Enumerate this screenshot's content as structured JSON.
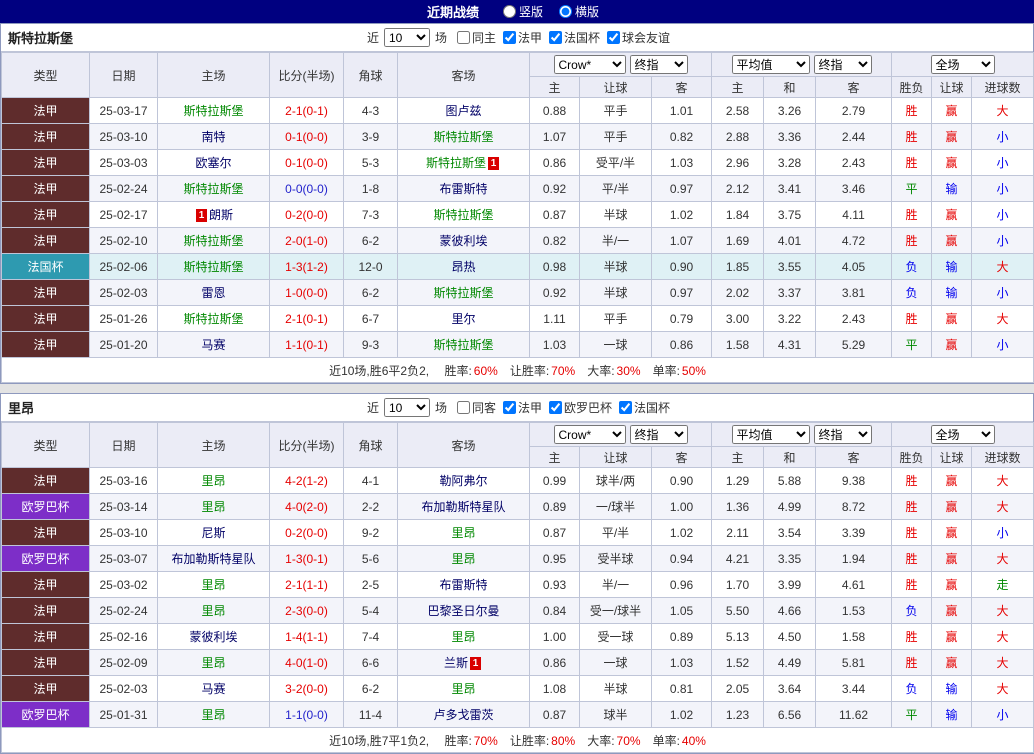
{
  "title_bar": {
    "title": "近期战绩",
    "layout_options": [
      {
        "label": "竖版",
        "checked": false
      },
      {
        "label": "横版",
        "checked": true
      }
    ]
  },
  "filter_labels": {
    "prefix": "近",
    "suffix": "场"
  },
  "table_header": {
    "type": "类型",
    "date": "日期",
    "home": "主场",
    "score": "比分(半场)",
    "corner": "角球",
    "away": "客场",
    "odds_source_select": "Crow*",
    "odds_time_select": "终指",
    "avg_select": "平均值",
    "avg_time_select": "终指",
    "scope_select": "全场",
    "sub": [
      "主",
      "让球",
      "客",
      "主",
      "和",
      "客",
      "胜负",
      "让球",
      "进球数"
    ]
  },
  "colors": {
    "leagues": {
      "法甲": "#5F2C2C",
      "法国杯": "#2E9AB0",
      "欧罗巴杯": "#7D2EC8"
    },
    "cup_row_bg": {
      "法国杯": "#DFF1F5"
    },
    "focus_team": "#008800",
    "team": "#000066",
    "score_red": "#E60000",
    "score_blue": "#2222CC",
    "outcome": {
      "胜": "#E60000",
      "平": "#008800",
      "负": "#0000EE",
      "赢": "#E60000",
      "走": "#008800",
      "输": "#0000EE",
      "大": "#E60000",
      "小": "#0000EE"
    }
  },
  "sections": [
    {
      "team": "斯特拉斯堡",
      "filter": {
        "count": "10",
        "checkboxes": [
          {
            "label": "同主",
            "checked": false
          },
          {
            "label": "法甲",
            "checked": true
          },
          {
            "label": "法国杯",
            "checked": true
          },
          {
            "label": "球会友谊",
            "checked": true
          }
        ]
      },
      "rows": [
        {
          "league": "法甲",
          "date": "25-03-17",
          "home": "斯特拉斯堡",
          "home_focus": true,
          "home_card": "",
          "away": "图卢兹",
          "away_focus": false,
          "away_card": "",
          "score": "2-1(0-1)",
          "score_color": "red",
          "corner": "4-3",
          "o1": "0.88",
          "handicap": "平手",
          "o2": "1.01",
          "a1": "2.58",
          "a2": "3.26",
          "a3": "2.79",
          "res": "胜",
          "let": "赢",
          "goal": "大"
        },
        {
          "league": "法甲",
          "date": "25-03-10",
          "home": "南特",
          "home_focus": false,
          "home_card": "",
          "away": "斯特拉斯堡",
          "away_focus": true,
          "away_card": "",
          "score": "0-1(0-0)",
          "score_color": "red",
          "corner": "3-9",
          "o1": "1.07",
          "handicap": "平手",
          "o2": "0.82",
          "a1": "2.88",
          "a2": "3.36",
          "a3": "2.44",
          "res": "胜",
          "let": "赢",
          "goal": "小"
        },
        {
          "league": "法甲",
          "date": "25-03-03",
          "home": "欧塞尔",
          "home_focus": false,
          "home_card": "",
          "away": "斯特拉斯堡",
          "away_focus": true,
          "away_card": "1",
          "score": "0-1(0-0)",
          "score_color": "red",
          "corner": "5-3",
          "o1": "0.86",
          "handicap": "受平/半",
          "o2": "1.03",
          "a1": "2.96",
          "a2": "3.28",
          "a3": "2.43",
          "res": "胜",
          "let": "赢",
          "goal": "小"
        },
        {
          "league": "法甲",
          "date": "25-02-24",
          "home": "斯特拉斯堡",
          "home_focus": true,
          "home_card": "",
          "away": "布雷斯特",
          "away_focus": false,
          "away_card": "",
          "score": "0-0(0-0)",
          "score_color": "blue",
          "corner": "1-8",
          "o1": "0.92",
          "handicap": "平/半",
          "o2": "0.97",
          "a1": "2.12",
          "a2": "3.41",
          "a3": "3.46",
          "res": "平",
          "let": "输",
          "goal": "小"
        },
        {
          "league": "法甲",
          "date": "25-02-17",
          "home": "朗斯",
          "home_focus": false,
          "home_card": "1",
          "away": "斯特拉斯堡",
          "away_focus": true,
          "away_card": "",
          "score": "0-2(0-0)",
          "score_color": "red",
          "corner": "7-3",
          "o1": "0.87",
          "handicap": "半球",
          "o2": "1.02",
          "a1": "1.84",
          "a2": "3.75",
          "a3": "4.11",
          "res": "胜",
          "let": "赢",
          "goal": "小"
        },
        {
          "league": "法甲",
          "date": "25-02-10",
          "home": "斯特拉斯堡",
          "home_focus": true,
          "home_card": "",
          "away": "蒙彼利埃",
          "away_focus": false,
          "away_card": "",
          "score": "2-0(1-0)",
          "score_color": "red",
          "corner": "6-2",
          "o1": "0.82",
          "handicap": "半/一",
          "o2": "1.07",
          "a1": "1.69",
          "a2": "4.01",
          "a3": "4.72",
          "res": "胜",
          "let": "赢",
          "goal": "小"
        },
        {
          "league": "法国杯",
          "date": "25-02-06",
          "home": "斯特拉斯堡",
          "home_focus": true,
          "home_card": "",
          "away": "昂热",
          "away_focus": false,
          "away_card": "",
          "score": "1-3(1-2)",
          "score_color": "red",
          "corner": "12-0",
          "o1": "0.98",
          "handicap": "半球",
          "o2": "0.90",
          "a1": "1.85",
          "a2": "3.55",
          "a3": "4.05",
          "res": "负",
          "let": "输",
          "goal": "大"
        },
        {
          "league": "法甲",
          "date": "25-02-03",
          "home": "雷恩",
          "home_focus": false,
          "home_card": "",
          "away": "斯特拉斯堡",
          "away_focus": true,
          "away_card": "",
          "score": "1-0(0-0)",
          "score_color": "red",
          "corner": "6-2",
          "o1": "0.92",
          "handicap": "半球",
          "o2": "0.97",
          "a1": "2.02",
          "a2": "3.37",
          "a3": "3.81",
          "res": "负",
          "let": "输",
          "goal": "小"
        },
        {
          "league": "法甲",
          "date": "25-01-26",
          "home": "斯特拉斯堡",
          "home_focus": true,
          "home_card": "",
          "away": "里尔",
          "away_focus": false,
          "away_card": "",
          "score": "2-1(0-1)",
          "score_color": "red",
          "corner": "6-7",
          "o1": "1.11",
          "handicap": "平手",
          "o2": "0.79",
          "a1": "3.00",
          "a2": "3.22",
          "a3": "2.43",
          "res": "胜",
          "let": "赢",
          "goal": "大"
        },
        {
          "league": "法甲",
          "date": "25-01-20",
          "home": "马赛",
          "home_focus": false,
          "home_card": "",
          "away": "斯特拉斯堡",
          "away_focus": true,
          "away_card": "",
          "score": "1-1(0-1)",
          "score_color": "red",
          "corner": "9-3",
          "o1": "1.03",
          "handicap": "一球",
          "o2": "0.86",
          "a1": "1.58",
          "a2": "4.31",
          "a3": "5.29",
          "res": "平",
          "let": "赢",
          "goal": "小"
        }
      ],
      "summary": {
        "prefix": "近10场,胜6平2负2, ",
        "stats": [
          {
            "label": "胜率:",
            "value": "60%"
          },
          {
            "label": "让胜率:",
            "value": "70%"
          },
          {
            "label": "大率:",
            "value": "30%"
          },
          {
            "label": "单率:",
            "value": "50%"
          }
        ]
      }
    },
    {
      "team": "里昂",
      "filter": {
        "count": "10",
        "checkboxes": [
          {
            "label": "同客",
            "checked": false
          },
          {
            "label": "法甲",
            "checked": true
          },
          {
            "label": "欧罗巴杯",
            "checked": true
          },
          {
            "label": "法国杯",
            "checked": true
          }
        ]
      },
      "rows": [
        {
          "league": "法甲",
          "date": "25-03-16",
          "home": "里昂",
          "home_focus": true,
          "home_card": "",
          "away": "勒阿弗尔",
          "away_focus": false,
          "away_card": "",
          "score": "4-2(1-2)",
          "score_color": "red",
          "corner": "4-1",
          "o1": "0.99",
          "handicap": "球半/两",
          "o2": "0.90",
          "a1": "1.29",
          "a2": "5.88",
          "a3": "9.38",
          "res": "胜",
          "let": "赢",
          "goal": "大"
        },
        {
          "league": "欧罗巴杯",
          "date": "25-03-14",
          "home": "里昂",
          "home_focus": true,
          "home_card": "",
          "away": "布加勒斯特星队",
          "away_focus": false,
          "away_card": "",
          "score": "4-0(2-0)",
          "score_color": "red",
          "corner": "2-2",
          "o1": "0.89",
          "handicap": "一/球半",
          "o2": "1.00",
          "a1": "1.36",
          "a2": "4.99",
          "a3": "8.72",
          "res": "胜",
          "let": "赢",
          "goal": "大"
        },
        {
          "league": "法甲",
          "date": "25-03-10",
          "home": "尼斯",
          "home_focus": false,
          "home_card": "",
          "away": "里昂",
          "away_focus": true,
          "away_card": "",
          "score": "0-2(0-0)",
          "score_color": "red",
          "corner": "9-2",
          "o1": "0.87",
          "handicap": "平/半",
          "o2": "1.02",
          "a1": "2.11",
          "a2": "3.54",
          "a3": "3.39",
          "res": "胜",
          "let": "赢",
          "goal": "小"
        },
        {
          "league": "欧罗巴杯",
          "date": "25-03-07",
          "home": "布加勒斯特星队",
          "home_focus": false,
          "home_card": "",
          "away": "里昂",
          "away_focus": true,
          "away_card": "",
          "score": "1-3(0-1)",
          "score_color": "red",
          "corner": "5-6",
          "o1": "0.95",
          "handicap": "受半球",
          "o2": "0.94",
          "a1": "4.21",
          "a2": "3.35",
          "a3": "1.94",
          "res": "胜",
          "let": "赢",
          "goal": "大"
        },
        {
          "league": "法甲",
          "date": "25-03-02",
          "home": "里昂",
          "home_focus": true,
          "home_card": "",
          "away": "布雷斯特",
          "away_focus": false,
          "away_card": "",
          "score": "2-1(1-1)",
          "score_color": "red",
          "corner": "2-5",
          "o1": "0.93",
          "handicap": "半/一",
          "o2": "0.96",
          "a1": "1.70",
          "a2": "3.99",
          "a3": "4.61",
          "res": "胜",
          "let": "赢",
          "goal": "走"
        },
        {
          "league": "法甲",
          "date": "25-02-24",
          "home": "里昂",
          "home_focus": true,
          "home_card": "",
          "away": "巴黎圣日尔曼",
          "away_focus": false,
          "away_card": "",
          "score": "2-3(0-0)",
          "score_color": "red",
          "corner": "5-4",
          "o1": "0.84",
          "handicap": "受一/球半",
          "o2": "1.05",
          "a1": "5.50",
          "a2": "4.66",
          "a3": "1.53",
          "res": "负",
          "let": "赢",
          "goal": "大"
        },
        {
          "league": "法甲",
          "date": "25-02-16",
          "home": "蒙彼利埃",
          "home_focus": false,
          "home_card": "",
          "away": "里昂",
          "away_focus": true,
          "away_card": "",
          "score": "1-4(1-1)",
          "score_color": "red",
          "corner": "7-4",
          "o1": "1.00",
          "handicap": "受一球",
          "o2": "0.89",
          "a1": "5.13",
          "a2": "4.50",
          "a3": "1.58",
          "res": "胜",
          "let": "赢",
          "goal": "大"
        },
        {
          "league": "法甲",
          "date": "25-02-09",
          "home": "里昂",
          "home_focus": true,
          "home_card": "",
          "away": "兰斯",
          "away_focus": false,
          "away_card": "1",
          "score": "4-0(1-0)",
          "score_color": "red",
          "corner": "6-6",
          "o1": "0.86",
          "handicap": "一球",
          "o2": "1.03",
          "a1": "1.52",
          "a2": "4.49",
          "a3": "5.81",
          "res": "胜",
          "let": "赢",
          "goal": "大"
        },
        {
          "league": "法甲",
          "date": "25-02-03",
          "home": "马赛",
          "home_focus": false,
          "home_card": "",
          "away": "里昂",
          "away_focus": true,
          "away_card": "",
          "score": "3-2(0-0)",
          "score_color": "red",
          "corner": "6-2",
          "o1": "1.08",
          "handicap": "半球",
          "o2": "0.81",
          "a1": "2.05",
          "a2": "3.64",
          "a3": "3.44",
          "res": "负",
          "let": "输",
          "goal": "大"
        },
        {
          "league": "欧罗巴杯",
          "date": "25-01-31",
          "home": "里昂",
          "home_focus": true,
          "home_card": "",
          "away": "卢多戈雷茨",
          "away_focus": false,
          "away_card": "",
          "score": "1-1(0-0)",
          "score_color": "blue",
          "corner": "11-4",
          "o1": "0.87",
          "handicap": "球半",
          "o2": "1.02",
          "a1": "1.23",
          "a2": "6.56",
          "a3": "11.62",
          "res": "平",
          "let": "输",
          "goal": "小"
        }
      ],
      "summary": {
        "prefix": "近10场,胜7平1负2, ",
        "stats": [
          {
            "label": "胜率:",
            "value": "70%"
          },
          {
            "label": "让胜率:",
            "value": "80%"
          },
          {
            "label": "大率:",
            "value": "70%"
          },
          {
            "label": "单率:",
            "value": "40%"
          }
        ]
      }
    }
  ]
}
